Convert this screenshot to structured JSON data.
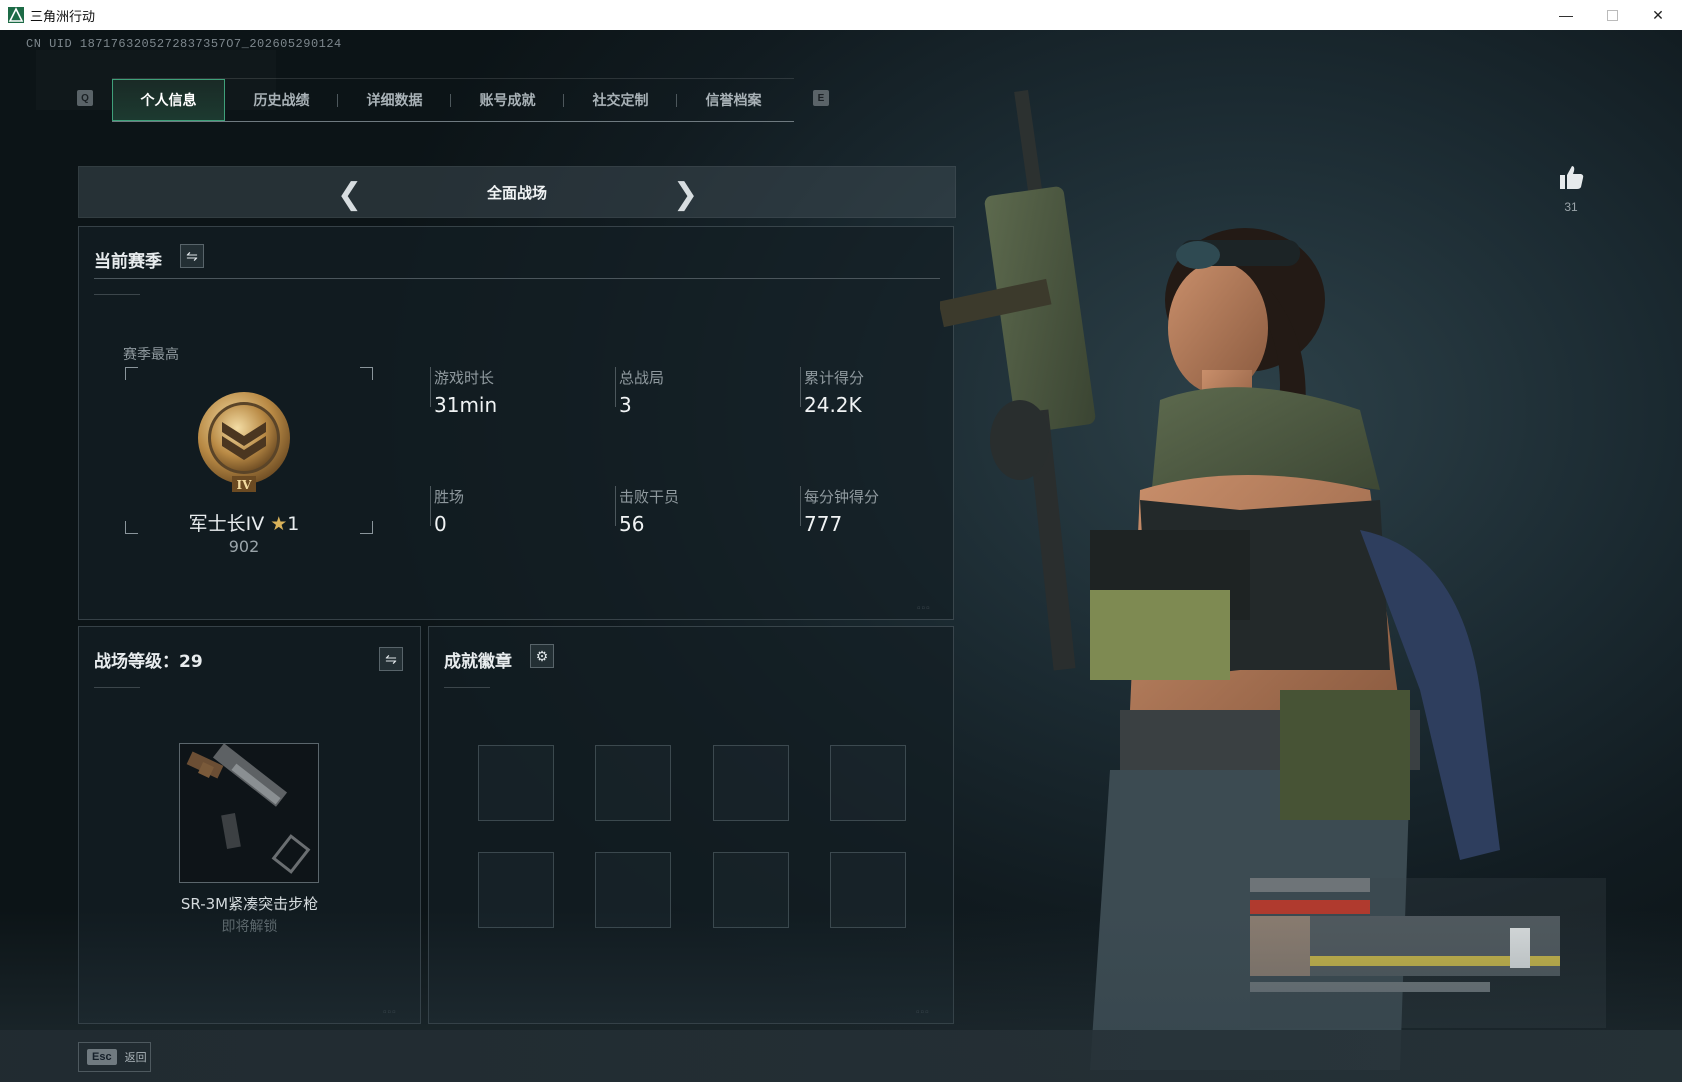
{
  "window": {
    "title": "三角洲行动",
    "controls": [
      "minimize",
      "maximize",
      "close"
    ]
  },
  "header": {
    "uid": "CN UID 1871763205272837357O7_202605290124",
    "left_key": "Q",
    "right_key": "E"
  },
  "tabs": [
    {
      "label": "个人信息",
      "active": true
    },
    {
      "label": "历史战绩",
      "active": false
    },
    {
      "label": "详细数据",
      "active": false
    },
    {
      "label": "账号成就",
      "active": false
    },
    {
      "label": "社交定制",
      "active": false
    },
    {
      "label": "信誉档案",
      "active": false
    }
  ],
  "mode_selector": {
    "current": "全面战场",
    "prev_icon": "chevron-left-icon",
    "next_icon": "chevron-right-icon"
  },
  "season": {
    "title": "当前赛季",
    "best_label": "赛季最高",
    "rank_name": "军士长IV",
    "rank_stars": "1",
    "rank_points": "902",
    "rank_emblem_numeral": "IV",
    "stats": [
      {
        "label": "游戏时长",
        "value": "31min"
      },
      {
        "label": "总战局",
        "value": "3"
      },
      {
        "label": "累计得分",
        "value": "24.2K"
      },
      {
        "label": "胜场",
        "value": "0"
      },
      {
        "label": "击败干员",
        "value": "56"
      },
      {
        "label": "每分钟得分",
        "value": "777"
      }
    ]
  },
  "level_panel": {
    "title": "战场等级：29",
    "weapon_name": "SR-3M紧凑突击步枪",
    "weapon_status": "即将解锁"
  },
  "badges_panel": {
    "title": "成就徽章",
    "slots": 8
  },
  "likes": {
    "count": "31",
    "icon": "thumbs-up-icon"
  },
  "footer": {
    "esc_key": "Esc",
    "back_label": "返回"
  },
  "colors": {
    "accent": "#3fa07a",
    "star": "#d9b25a",
    "background": "#0d1519"
  }
}
